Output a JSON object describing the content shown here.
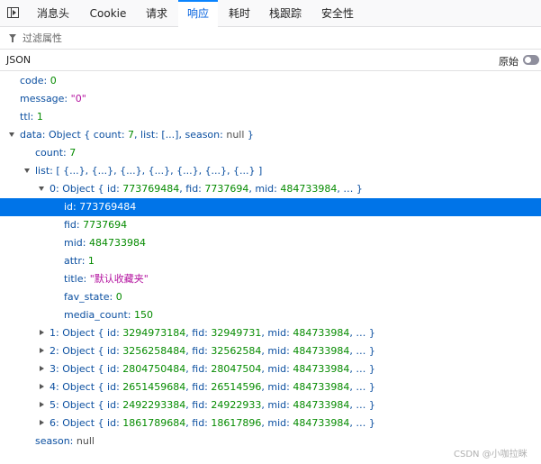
{
  "tabs": {
    "t1": "消息头",
    "t2": "Cookie",
    "t3": "请求",
    "t4": "响应",
    "t5": "耗时",
    "t6": "栈跟踪",
    "t7": "安全性"
  },
  "filter": {
    "placeholder": "过滤属性"
  },
  "viewbar": {
    "json_label": "JSON",
    "raw_label": "原始",
    "raw_on": false
  },
  "tree": {
    "code_key": "code:",
    "code_val": "0",
    "message_key": "message:",
    "message_val": "\"0\"",
    "ttl_key": "ttl:",
    "ttl_val": "1",
    "data_key": "data:",
    "data_prefix": "Object { count:",
    "data_count": "7",
    "data_mid": ", list: [...], season:",
    "data_null": "null",
    "data_suffix": "}",
    "count_key": "count:",
    "count_val": "7",
    "list_key": "list:",
    "list_summary": "[ {...}, {...}, {...}, {...}, {...}, {...}, {...} ]",
    "o0_key": "0:",
    "o0_prefix": "Object { id:",
    "o0_id": "773769484",
    "o0_c1": ", fid:",
    "o0_fid": "7737694",
    "o0_c2": ", mid:",
    "o0_mid": "484733984",
    "o0_suffix": ", … }",
    "id_key": "id:",
    "id_val": "773769484",
    "fid_key": "fid:",
    "fid_val": "7737694",
    "mid_key": "mid:",
    "mid_val": "484733984",
    "attr_key": "attr:",
    "attr_val": "1",
    "title_key": "title:",
    "title_val": "\"默认收藏夹\"",
    "favstate_key": "fav_state:",
    "favstate_val": "0",
    "mediacount_key": "media_count:",
    "mediacount_val": "150",
    "o1_key": "1:",
    "o1_prefix": "Object { id:",
    "o1_id": "3294973184",
    "o1_c1": ", fid:",
    "o1_fid": "32949731",
    "o1_c2": ", mid:",
    "o1_mid": "484733984",
    "o1_suffix": ", … }",
    "o2_key": "2:",
    "o2_prefix": "Object { id:",
    "o2_id": "3256258484",
    "o2_c1": ", fid:",
    "o2_fid": "32562584",
    "o2_c2": ", mid:",
    "o2_mid": "484733984",
    "o2_suffix": ", … }",
    "o3_key": "3:",
    "o3_prefix": "Object { id:",
    "o3_id": "2804750484",
    "o3_c1": ", fid:",
    "o3_fid": "28047504",
    "o3_c2": ", mid:",
    "o3_mid": "484733984",
    "o3_suffix": ", … }",
    "o4_key": "4:",
    "o4_prefix": "Object { id:",
    "o4_id": "2651459684",
    "o4_c1": ", fid:",
    "o4_fid": "26514596",
    "o4_c2": ", mid:",
    "o4_mid": "484733984",
    "o4_suffix": ", … }",
    "o5_key": "5:",
    "o5_prefix": "Object { id:",
    "o5_id": "2492293384",
    "o5_c1": ", fid:",
    "o5_fid": "24922933",
    "o5_c2": ", mid:",
    "o5_mid": "484733984",
    "o5_suffix": ", … }",
    "o6_key": "6:",
    "o6_prefix": "Object { id:",
    "o6_id": "1861789684",
    "o6_c1": ", fid:",
    "o6_fid": "18617896",
    "o6_c2": ", mid:",
    "o6_mid": "484733984",
    "o6_suffix": ", … }",
    "season_key": "season:",
    "season_val": "null"
  },
  "watermark": "CSDN @小咖拉眯"
}
